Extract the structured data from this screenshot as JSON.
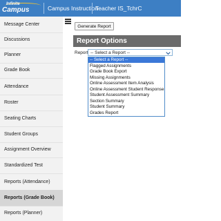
{
  "header": {
    "logo_top": "Infinite",
    "logo_main": "Campus",
    "title": "Campus Instruction",
    "user": "Teacher IS_TchrC",
    "colors": {
      "bar": "#3d7fc4",
      "logo_accent": "#f1c232"
    }
  },
  "sidebar": {
    "items": [
      {
        "label": "Message Center"
      },
      {
        "label": "Discussions"
      },
      {
        "label": "Planner"
      },
      {
        "label": "Grade Book"
      },
      {
        "label": "Attendance"
      },
      {
        "label": "Roster"
      },
      {
        "label": "Seating Charts"
      },
      {
        "label": "Student Groups"
      },
      {
        "label": "Assignment Overview"
      },
      {
        "label": "Standardized Test"
      },
      {
        "label": "Reports (Attendance)"
      },
      {
        "label": "Reports (Grade Book)",
        "active": true
      },
      {
        "label": "Reports (Planner)"
      }
    ]
  },
  "toolbar": {
    "generate_label": "Generate Report"
  },
  "report_options": {
    "header": "Report Options",
    "report_label": "Report",
    "selected": "-- Select a Report --",
    "options": [
      "-- Select a Report --",
      "Flagged Assignments",
      "Grade Book Export",
      "Missing Assignments",
      "Online Assessment Item Analysis",
      "Online Assessment Student Response",
      "Student Assessment Summary",
      "Section Summary",
      "Student Summary",
      "Grades Report"
    ]
  }
}
